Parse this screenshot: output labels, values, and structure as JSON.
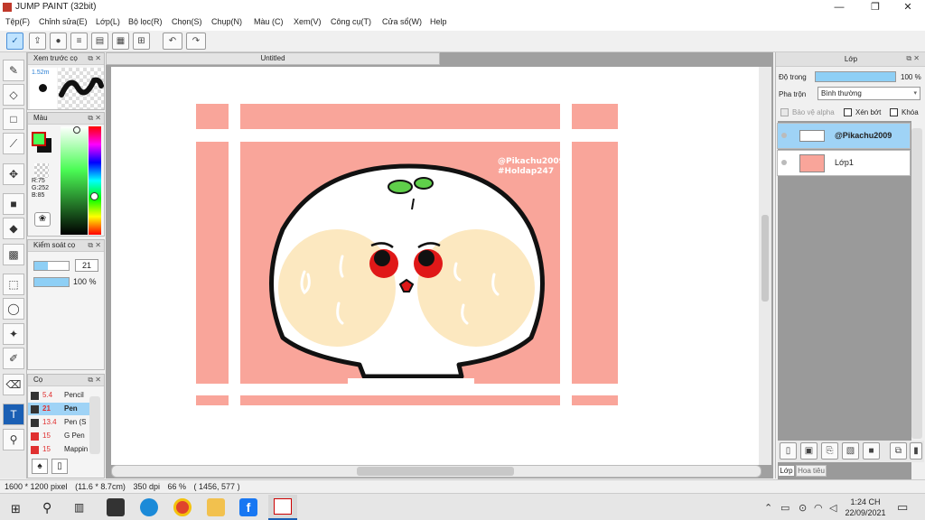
{
  "window": {
    "title": "JUMP PAINT (32bit)",
    "controls": {
      "minimize": "—",
      "maximize": "❐",
      "close": "✕"
    }
  },
  "menu": [
    "Tệp(F)",
    "Chỉnh sửa(E)",
    "Lớp(L)",
    "Bộ lọc(R)",
    "Chọn(S)",
    "Chụp(N)",
    "Màu (C)",
    "Xem(V)",
    "Công cụ(T)",
    "Cửa sổ(W)",
    "Help"
  ],
  "toolbar_icons": [
    "check-icon",
    "export-icon",
    "speech-icon",
    "list-icon",
    "document-icon",
    "grid-icon",
    "settings-grid-icon",
    "undo-icon",
    "redo-icon"
  ],
  "tools": [
    "brush-icon",
    "eraser-icon",
    "rect-icon",
    "pen-line-icon",
    "move-icon",
    "fill-rect-icon",
    "bucket-icon",
    "gradient-icon",
    "select-rect-icon",
    "lasso-icon",
    "magic-wand-icon",
    "select-pen-icon",
    "select-eraser-icon",
    "text-icon",
    "eyedropper-icon"
  ],
  "brush_preview": {
    "title": "Xem trước cọ",
    "size": "1.52m"
  },
  "color_panel": {
    "title": "Màu",
    "r": "R:75",
    "g": "G:252",
    "b": "B:85",
    "fg": "#4bfc55",
    "bg": "#111111"
  },
  "brush_control": {
    "title": "Kiểm soát cọ",
    "size": "21",
    "opacity": "100 %"
  },
  "brush_list": {
    "title": "Cọ",
    "items": [
      {
        "size": "5.4",
        "name": "Pencil",
        "selected": false,
        "color": "#333333"
      },
      {
        "size": "21",
        "name": "Pen",
        "selected": true,
        "color": "#333333"
      },
      {
        "size": "13.4",
        "name": "Pen (S",
        "selected": false,
        "color": "#333333"
      },
      {
        "size": "15",
        "name": "G Pen",
        "selected": false,
        "color": "#e03030"
      },
      {
        "size": "15",
        "name": "Mappin",
        "selected": false,
        "color": "#e03030"
      }
    ]
  },
  "canvas": {
    "tab_title": "Untitled",
    "watermark_line1": "@Pikachu2009",
    "watermark_line2": "#Holdap247",
    "bg_color": "#ffffff",
    "pink": "#f9a59a"
  },
  "layer_panel": {
    "title": "Lớp",
    "opacity_label": "Độ trong",
    "opacity_value": "100 %",
    "blend_label": "Pha trộn",
    "blend_value": "Bình thường",
    "protect_alpha": "Bảo vệ alpha",
    "clipping": "Xén bớt",
    "lock": "Khóa",
    "layers": [
      {
        "name": "@Pikachu2009",
        "selected": true
      },
      {
        "name": "Lớp1",
        "selected": false
      }
    ],
    "tabs": [
      "Lớp",
      "Hoa tiêu"
    ]
  },
  "status": {
    "size": "1600 * 1200 pixel",
    "physical": "(11.6 * 8.7cm)",
    "dpi": "350 dpi",
    "zoom": "66 %",
    "cursor": "( 1456, 577 )"
  },
  "taskbar": {
    "time": "1:24 CH",
    "date": "22/09/2021"
  }
}
